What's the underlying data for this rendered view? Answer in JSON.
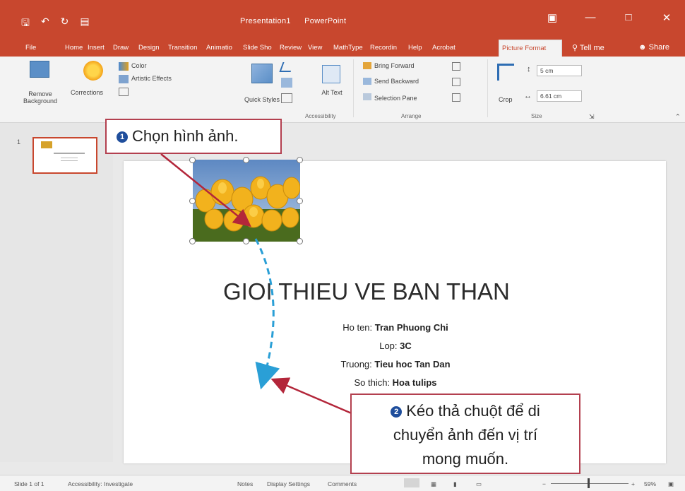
{
  "titlebar": {
    "title": "Presentation1",
    "app": "PowerPoint",
    "qat_icons": [
      "save-icon",
      "undo-icon",
      "redo-icon",
      "start-slideshow-icon"
    ]
  },
  "tabs": [
    {
      "id": "file",
      "label": "File"
    },
    {
      "id": "home",
      "label": "Home"
    },
    {
      "id": "insert",
      "label": "Insert"
    },
    {
      "id": "draw",
      "label": "Draw"
    },
    {
      "id": "design",
      "label": "Design"
    },
    {
      "id": "transitions",
      "label": "Transition"
    },
    {
      "id": "animations",
      "label": "Animatio"
    },
    {
      "id": "slideshow",
      "label": "Slide Sho"
    },
    {
      "id": "review",
      "label": "Review"
    },
    {
      "id": "view",
      "label": "View"
    },
    {
      "id": "mathtype",
      "label": "MathType"
    },
    {
      "id": "recording",
      "label": "Recordin"
    },
    {
      "id": "help",
      "label": "Help"
    },
    {
      "id": "acrobat",
      "label": "Acrobat"
    }
  ],
  "active_tab": "Picture Format",
  "tell_me": "Tell me",
  "share": "Share",
  "ribbon": {
    "remove_background": "Remove Background",
    "corrections": "Corrections",
    "color": "Color",
    "artistic_effects": "Artistic Effects",
    "quick_styles": "Quick Styles",
    "alt_text": "Alt Text",
    "bring_forward": "Bring Forward",
    "send_backward": "Send Backward",
    "selection_pane": "Selection Pane",
    "crop": "Crop",
    "height": "5 cm",
    "width": "6.61 cm",
    "group_accessibility": "Accessibility",
    "group_arrange": "Arrange",
    "group_size": "Size"
  },
  "thumbnail": {
    "number": "1"
  },
  "slide": {
    "title": "GIOI THIEU VE BAN THAN",
    "lines": [
      {
        "label": "Ho ten: ",
        "value": "Tran Phuong Chi"
      },
      {
        "label": "Lop: ",
        "value": "3C"
      },
      {
        "label": "Truong: ",
        "value": "Tieu hoc Tan Dan"
      },
      {
        "label": "So thich: ",
        "value": "Hoa tulips"
      }
    ]
  },
  "callouts": {
    "step1_number": "1",
    "step1_text": "Chọn hình ảnh.",
    "step2_number": "2",
    "step2_line1": "Kéo thả chuột để di",
    "step2_line2": "chuyển ảnh đến vị trí",
    "step2_line3": "mong muốn."
  },
  "statusbar": {
    "slide_of": "Slide 1 of 1",
    "accessibility": "Accessibility: Investigate",
    "notes": "Notes",
    "display_settings": "Display Settings",
    "comments": "Comments",
    "zoom": "59%"
  },
  "colors": {
    "accent": "#c8472e",
    "callout_border": "#b3404f",
    "step_badge": "#1f4e9c",
    "drag_path": "#2a9fd6",
    "arrow": "#b3263a"
  }
}
